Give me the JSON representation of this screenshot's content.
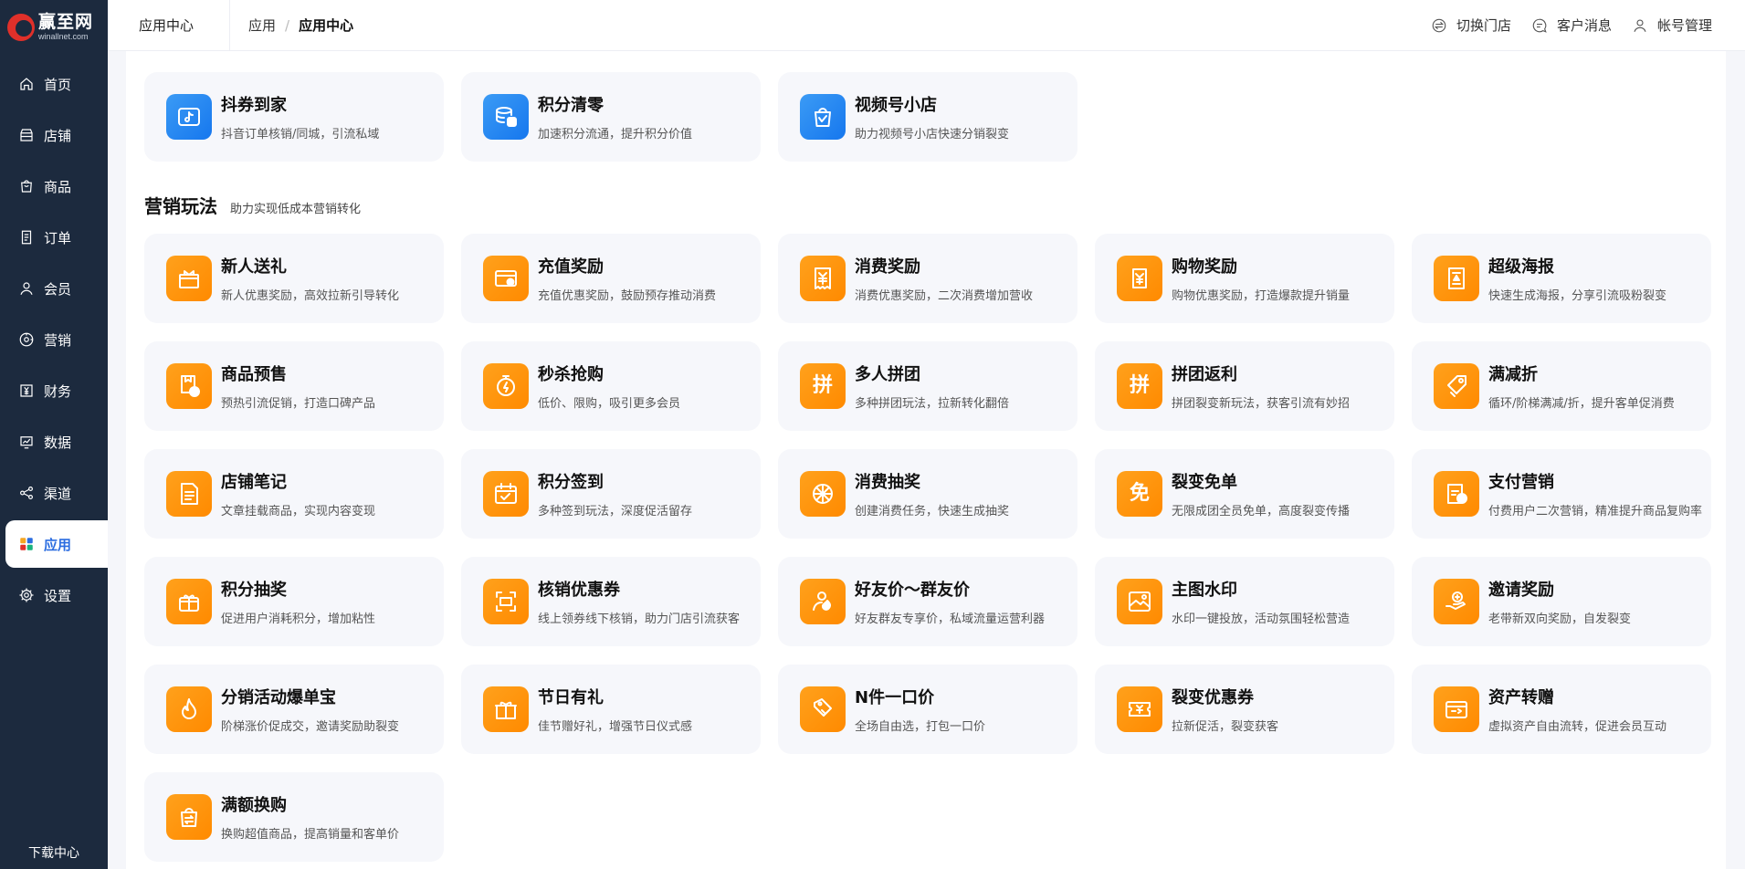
{
  "brand": {
    "name": "赢至网",
    "domain": "winallnet.com"
  },
  "sidebar": {
    "items": [
      {
        "label": "首页",
        "icon": "home-icon"
      },
      {
        "label": "店铺",
        "icon": "store-icon"
      },
      {
        "label": "商品",
        "icon": "bag-icon"
      },
      {
        "label": "订单",
        "icon": "order-icon"
      },
      {
        "label": "会员",
        "icon": "user-icon"
      },
      {
        "label": "营销",
        "icon": "marketing-icon"
      },
      {
        "label": "财务",
        "icon": "yuan-icon"
      },
      {
        "label": "数据",
        "icon": "chart-icon"
      },
      {
        "label": "渠道",
        "icon": "share-icon"
      },
      {
        "label": "应用",
        "icon": "apps-icon"
      },
      {
        "label": "设置",
        "icon": "gear-icon"
      }
    ],
    "active_index": 9,
    "download_label": "下载中心"
  },
  "topbar": {
    "title": "应用中心",
    "breadcrumb": [
      "应用",
      "应用中心"
    ],
    "breadcrumb_sep": "/",
    "actions": [
      {
        "label": "切换门店",
        "icon": "switch-icon"
      },
      {
        "label": "客户消息",
        "icon": "message-icon"
      },
      {
        "label": "帐号管理",
        "icon": "account-icon"
      }
    ]
  },
  "top_apps": [
    {
      "title": "抖券到家",
      "desc": "抖音订单核销/同城，引流私域",
      "icon": "douyin-ticket-icon",
      "color": "blue"
    },
    {
      "title": "积分清零",
      "desc": "加速积分流通，提升积分价值",
      "icon": "coins-stack-icon",
      "color": "blue"
    },
    {
      "title": "视频号小店",
      "desc": "助力视频号小店快速分销裂变",
      "icon": "video-shop-icon",
      "color": "blue"
    }
  ],
  "marketing": {
    "title": "营销玩法",
    "subtitle": "助力实现低成本营销转化",
    "apps": [
      {
        "title": "新人送礼",
        "desc": "新人优惠奖励，高效拉新引导转化",
        "icon": "newcomer-gift-icon"
      },
      {
        "title": "充值奖励",
        "desc": "充值优惠奖励，鼓励预存推动消费",
        "icon": "recharge-card-icon"
      },
      {
        "title": "消费奖励",
        "desc": "消费优惠奖励，二次消费增加营收",
        "icon": "yuan-receipt-icon"
      },
      {
        "title": "购物奖励",
        "desc": "购物优惠奖励，打造爆款提升销量",
        "icon": "shopping-reward-icon"
      },
      {
        "title": "超级海报",
        "desc": "快速生成海报，分享引流吸粉裂变",
        "icon": "poster-icon"
      },
      {
        "title": "商品预售",
        "desc": "预热引流促销，打造口碑产品",
        "icon": "presale-clock-icon"
      },
      {
        "title": "秒杀抢购",
        "desc": "低价、限购，吸引更多会员",
        "icon": "flash-timer-icon"
      },
      {
        "title": "多人拼团",
        "desc": "多种拼团玩法，拉新转化翻倍",
        "icon": "group-buy-icon",
        "glyph": "拼"
      },
      {
        "title": "拼团返利",
        "desc": "拼团裂变新玩法，获客引流有妙招",
        "icon": "group-rebate-icon",
        "glyph": "拼"
      },
      {
        "title": "满减折",
        "desc": "循环/阶梯满减/折，提升客单促消费",
        "icon": "discount-tag-icon"
      },
      {
        "title": "店铺笔记",
        "desc": "文章挂载商品，实现内容变现",
        "icon": "note-icon"
      },
      {
        "title": "积分签到",
        "desc": "多种签到玩法，深度促活留存",
        "icon": "calendar-check-icon"
      },
      {
        "title": "消费抽奖",
        "desc": "创建消费任务，快速生成抽奖",
        "icon": "lottery-wheel-icon"
      },
      {
        "title": "裂变免单",
        "desc": "无限成团全员免单，高度裂变传播",
        "icon": "free-order-icon",
        "glyph": "免"
      },
      {
        "title": "支付营销",
        "desc": "付费用户二次营销，精准提升商品复购率",
        "icon": "pay-marketing-icon"
      },
      {
        "title": "积分抽奖",
        "desc": "促进用户消耗积分，增加粘性",
        "icon": "points-lottery-icon"
      },
      {
        "title": "核销优惠券",
        "desc": "线上领券线下核销，助力门店引流获客",
        "icon": "scan-coupon-icon"
      },
      {
        "title": "好友价～群友价",
        "desc": "好友群友专享价，私域流量运营利器",
        "icon": "friend-price-icon"
      },
      {
        "title": "主图水印",
        "desc": "水印一键投放，活动氛围轻松营造",
        "icon": "watermark-icon"
      },
      {
        "title": "邀请奖励",
        "desc": "老带新双向奖励，自发裂变",
        "icon": "invite-reward-icon"
      },
      {
        "title": "分销活动爆单宝",
        "desc": "阶梯涨价促成交，邀请奖励助裂变",
        "icon": "fire-icon"
      },
      {
        "title": "节日有礼",
        "desc": "佳节赠好礼，增强节日仪式感",
        "icon": "gift-box-icon"
      },
      {
        "title": "N件一口价",
        "desc": "全场自由选，打包一口价",
        "icon": "price-tag-icon"
      },
      {
        "title": "裂变优惠券",
        "desc": "拉新促活，裂变获客",
        "icon": "coupon-icon"
      },
      {
        "title": "资产转赠",
        "desc": "虚拟资产自由流转，促进会员互动",
        "icon": "transfer-icon"
      },
      {
        "title": "满额换购",
        "desc": "换购超值商品，提高销量和客单价",
        "icon": "swap-bag-icon"
      }
    ]
  },
  "colors": {
    "sidebar_bg": "#1c2a3e",
    "accent_blue": "#1677ee",
    "accent_orange": "#ff8a00",
    "active_text": "#2b6de0"
  }
}
